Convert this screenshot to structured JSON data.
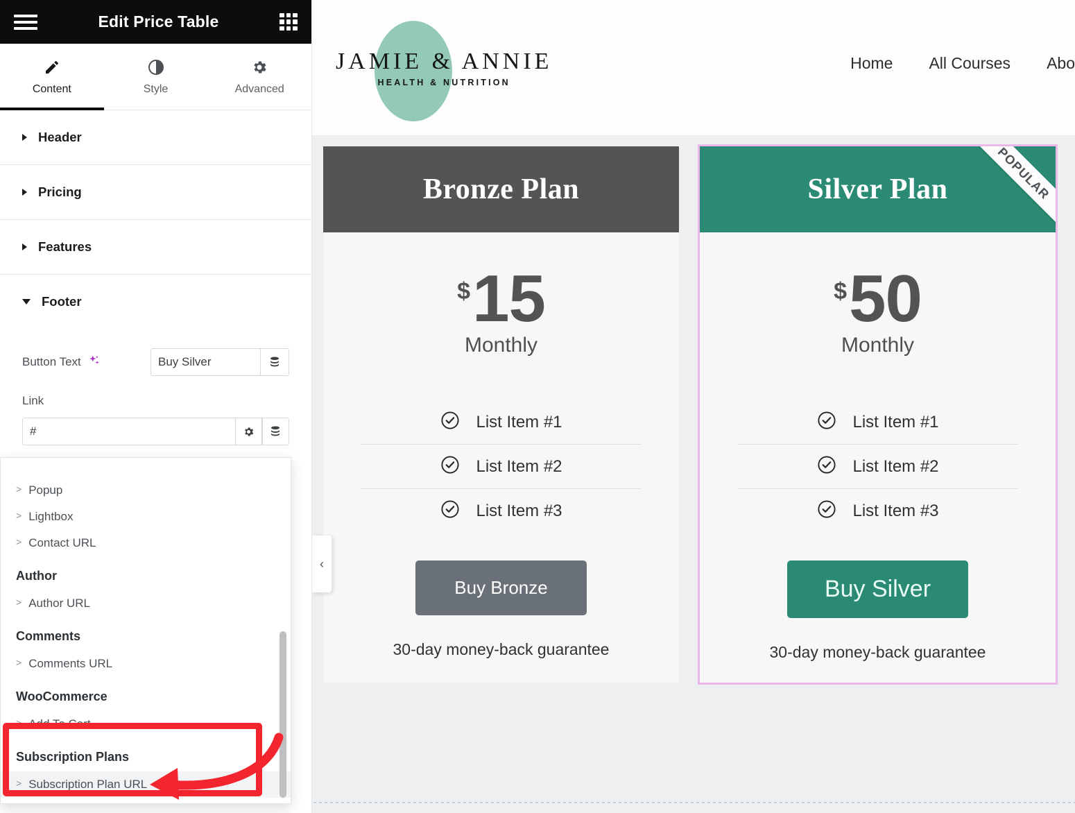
{
  "panel": {
    "title": "Edit Price Table",
    "menu_icon": "hamburger-icon",
    "apps_icon": "grid-apps-icon",
    "tabs": [
      {
        "label": "Content",
        "icon": "pencil-icon",
        "active": true
      },
      {
        "label": "Style",
        "icon": "contrast-half-circle-icon",
        "active": false
      },
      {
        "label": "Advanced",
        "icon": "gear-icon",
        "active": false
      }
    ],
    "sections": [
      {
        "label": "Header",
        "open": false
      },
      {
        "label": "Pricing",
        "open": false
      },
      {
        "label": "Features",
        "open": false
      },
      {
        "label": "Footer",
        "open": true
      }
    ],
    "footer_controls": {
      "button_text_label": "Button Text",
      "button_text_value": "Buy Silver",
      "button_text_placeholder": "Buy Silver",
      "ai_icon": "ai-sparkle-icon",
      "dynamic_tag_icon": "database-stack-icon",
      "link_label": "Link",
      "link_value": "#",
      "link_placeholder": "#",
      "link_settings_icon": "gear-icon"
    },
    "dynamic_dropdown": {
      "items": [
        {
          "type": "item",
          "label": "Popup"
        },
        {
          "type": "item",
          "label": "Lightbox"
        },
        {
          "type": "item",
          "label": "Contact URL"
        },
        {
          "type": "group",
          "label": "Author"
        },
        {
          "type": "item",
          "label": "Author URL"
        },
        {
          "type": "group",
          "label": "Comments"
        },
        {
          "type": "item",
          "label": "Comments URL"
        },
        {
          "type": "group",
          "label": "WooCommerce"
        },
        {
          "type": "item",
          "label": "Add To Cart"
        },
        {
          "type": "group",
          "label": "Subscription Plans"
        },
        {
          "type": "item",
          "label": "Subscription Plan URL",
          "highlighted": true
        }
      ],
      "caret": ">"
    },
    "collapse_handle_icon": "chevron-left-icon",
    "annotation_color": "#f3262f"
  },
  "site": {
    "logo": {
      "main": "JAMIE & ANNIE",
      "sub": "HEALTH & NUTRITION",
      "blob_color": "#93c9b6"
    },
    "nav": [
      {
        "label": "Home"
      },
      {
        "label": "All Courses"
      },
      {
        "label": "Abo"
      }
    ]
  },
  "plans": [
    {
      "name": "Bronze Plan",
      "header_color": "#535455",
      "currency": "$",
      "amount": "15",
      "period": "Monthly",
      "features": [
        "List Item #1",
        "List Item #2",
        "List Item #3"
      ],
      "cta_label": "Buy Bronze",
      "cta_color": "#6a7077",
      "guarantee": "30-day money-back guarantee",
      "ribbon": null,
      "selected": false,
      "check_icon": "check-circle-icon"
    },
    {
      "name": "Silver Plan",
      "header_color": "#2b8a74",
      "currency": "$",
      "amount": "50",
      "period": "Monthly",
      "features": [
        "List Item #1",
        "List Item #2",
        "List Item #3"
      ],
      "cta_label": "Buy Silver",
      "cta_color": "#2b8a74",
      "guarantee": "30-day money-back guarantee",
      "ribbon": "POPULAR",
      "selected": true,
      "check_icon": "check-circle-icon"
    }
  ]
}
